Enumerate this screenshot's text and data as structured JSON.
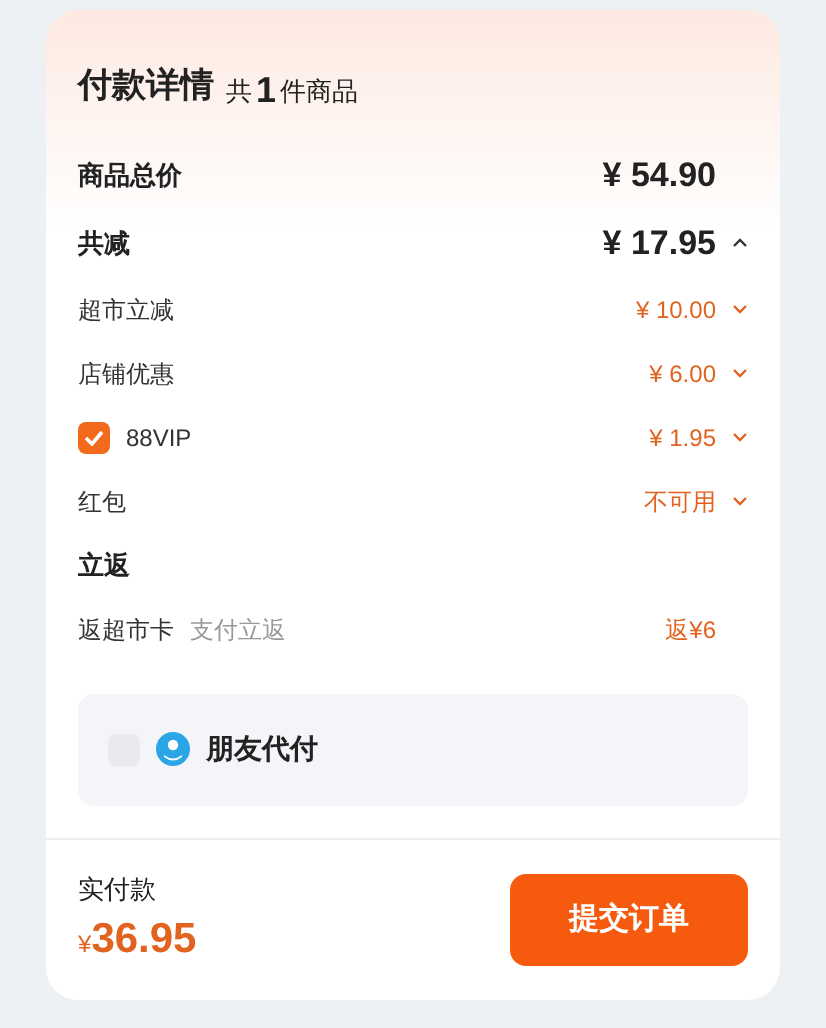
{
  "header": {
    "title": "付款详情",
    "count_prefix": "共",
    "count": "1",
    "count_suffix": "件商品"
  },
  "summary": [
    {
      "label": "商品总价",
      "amount": "¥ 54.90"
    },
    {
      "label": "共减",
      "amount": "¥ 17.95",
      "expanded": true
    }
  ],
  "discounts": [
    {
      "kind": "plain",
      "label": "超市立减",
      "amount": "¥ 10.00"
    },
    {
      "kind": "plain",
      "label": "店铺优惠",
      "amount": "¥ 6.00"
    },
    {
      "kind": "checkbox",
      "label": "88VIP",
      "amount": "¥ 1.95",
      "checked": true
    },
    {
      "kind": "plain",
      "label": "红包",
      "amount": "不可用"
    }
  ],
  "rebate": {
    "title": "立返",
    "label": "返超市卡",
    "note": "支付立返",
    "amount": "返¥6"
  },
  "friend_pay": {
    "label": "朋友代付",
    "checked": false
  },
  "footer": {
    "label": "实付款",
    "currency": "¥",
    "total": "36.95",
    "button": "提交订单"
  }
}
